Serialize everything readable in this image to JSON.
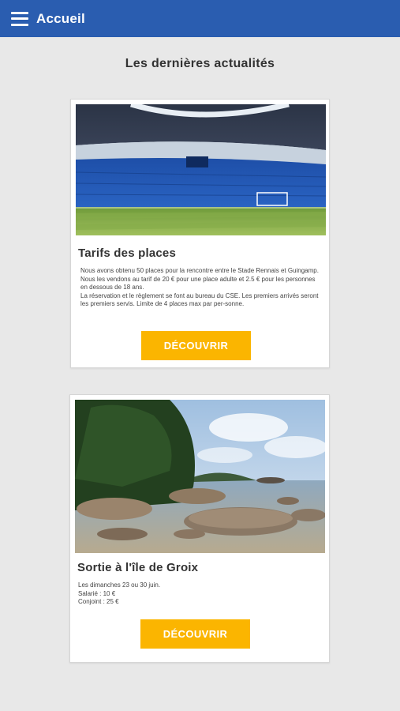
{
  "app_bar": {
    "title": "Accueil",
    "menu_icon": "hamburger-menu-icon",
    "color": "#2a5db0"
  },
  "section": {
    "title": "Les dernières actualités"
  },
  "articles": [
    {
      "title": "Tarifs des places",
      "image": "stadium-photo",
      "lines": [
        "Nous avons obtenu 50 places pour la rencontre entre le Stade Rennais et Guingamp.",
        "Nous les vendons au tarif de 20 € pour une place adulte et 2.5 € pour les personnes en dessous de 18 ans.",
        "La réservation et le règlement se font au bureau du CSE. Les premiers arrivés seront les premiers servis. Limite de 4 places max par per-sonne."
      ],
      "button_label": "DÉCOUVRIR"
    },
    {
      "title": "Sortie à l'île de Groix",
      "image": "island-coast-photo",
      "lines": [
        "Les dimanches 23 ou 30 juin.",
        "Salarié : 10 €",
        "Conjoint : 25 €"
      ],
      "button_label": "DÉCOUVRIR"
    }
  ],
  "colors": {
    "accent": "#fbb500",
    "background": "#e8e8e8"
  }
}
